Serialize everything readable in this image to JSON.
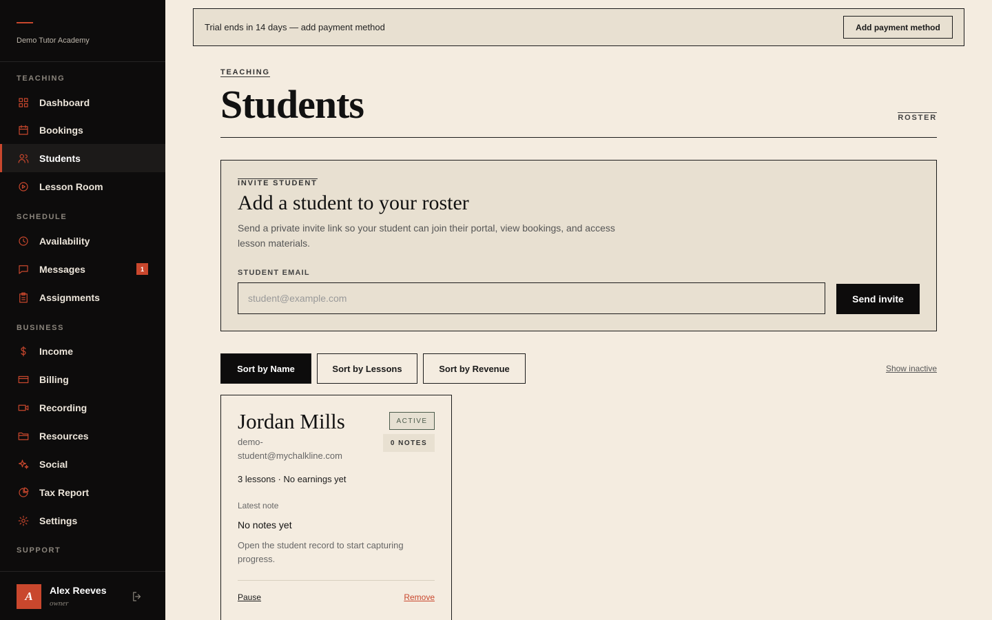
{
  "brand": {
    "name": "Demo Tutor Academy"
  },
  "sidebar": {
    "sections": [
      "TEACHING",
      "SCHEDULE",
      "BUSINESS",
      "SUPPORT"
    ],
    "items": [
      {
        "label": "Dashboard",
        "icon": "grid-icon"
      },
      {
        "label": "Bookings",
        "icon": "calendar-icon"
      },
      {
        "label": "Students",
        "icon": "users-icon",
        "active": true
      },
      {
        "label": "Lesson Room",
        "icon": "play-circle-icon"
      },
      {
        "label": "Availability",
        "icon": "clock-icon"
      },
      {
        "label": "Messages",
        "icon": "message-icon",
        "badge": "1"
      },
      {
        "label": "Assignments",
        "icon": "clipboard-icon"
      },
      {
        "label": "Income",
        "icon": "dollar-icon"
      },
      {
        "label": "Billing",
        "icon": "credit-card-icon"
      },
      {
        "label": "Recording",
        "icon": "video-icon"
      },
      {
        "label": "Resources",
        "icon": "folder-icon"
      },
      {
        "label": "Social",
        "icon": "sparkle-icon"
      },
      {
        "label": "Tax Report",
        "icon": "pie-chart-icon"
      },
      {
        "label": "Settings",
        "icon": "gear-icon"
      }
    ]
  },
  "user": {
    "initial": "A",
    "name": "Alex Reeves",
    "role": "owner"
  },
  "trial": {
    "text": "Trial ends in 14 days — add payment method",
    "button": "Add payment method"
  },
  "header": {
    "eyebrow": "TEACHING",
    "title": "Students",
    "tag": "ROSTER"
  },
  "invite": {
    "eyebrow": "INVITE STUDENT",
    "title": "Add a student to your roster",
    "description": "Send a private invite link so your student can join their portal, view bookings, and access lesson materials.",
    "email_label": "STUDENT EMAIL",
    "email_placeholder": "student@example.com",
    "email_value": "",
    "button": "Send invite"
  },
  "sort": {
    "buttons": [
      "Sort by Name",
      "Sort by Lessons",
      "Sort by Revenue"
    ],
    "active": "Sort by Name",
    "show_inactive": "Show inactive"
  },
  "students": [
    {
      "name": "Jordan Mills",
      "email": "demo-student@mychalkline.com",
      "status": "ACTIVE",
      "notes": "0 NOTES",
      "stats": "3 lessons · No earnings yet",
      "latest_label": "Latest note",
      "note_title": "No notes yet",
      "note_desc": "Open the student record to start capturing progress.",
      "pause": "Pause",
      "remove": "Remove"
    }
  ],
  "colors": {
    "accent": "#c9472d",
    "sidebar_bg": "#0d0c0c",
    "page_bg": "#f4ece0",
    "panel_bg": "#e8e0d1"
  }
}
